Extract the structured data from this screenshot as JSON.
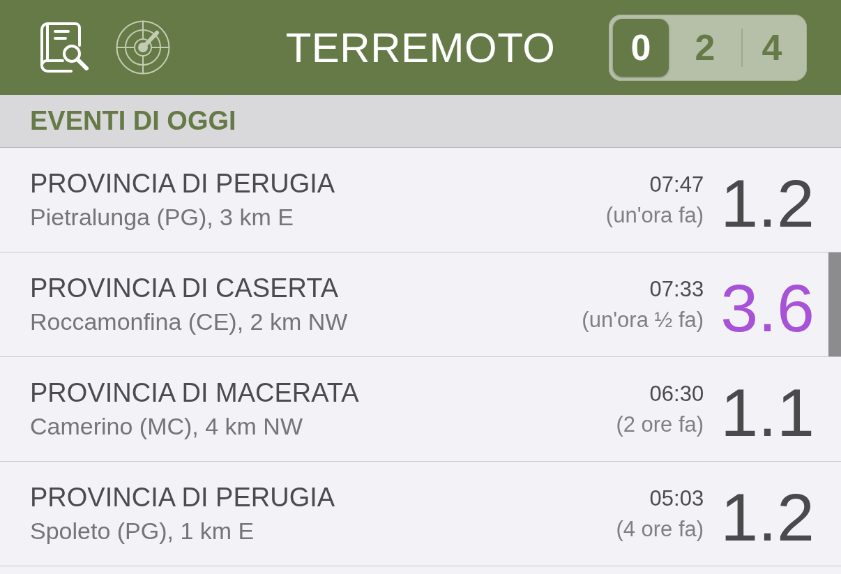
{
  "header": {
    "title": "TERREMOTO",
    "range_selector": [
      {
        "label": "0",
        "selected": true
      },
      {
        "label": "2",
        "selected": false
      },
      {
        "label": "4",
        "selected": false
      }
    ]
  },
  "section": {
    "title": "EVENTI DI OGGI"
  },
  "events": [
    {
      "region": "PROVINCIA DI PERUGIA",
      "place": "Pietralunga (PG), 3 km E",
      "time": "07:47",
      "ago": "(un'ora fa)",
      "magnitude": "1.2",
      "color": "#4a4a4c"
    },
    {
      "region": "PROVINCIA DI CASERTA",
      "place": "Roccamonfina (CE), 2 km NW",
      "time": "07:33",
      "ago": "(un'ora ½ fa)",
      "magnitude": "3.6",
      "color": "#a752d7"
    },
    {
      "region": "PROVINCIA DI MACERATA",
      "place": "Camerino (MC), 4 km NW",
      "time": "06:30",
      "ago": "(2 ore fa)",
      "magnitude": "1.1",
      "color": "#4a4a4c"
    },
    {
      "region": "PROVINCIA DI PERUGIA",
      "place": "Spoleto (PG), 1 km E",
      "time": "05:03",
      "ago": "(4 ore fa)",
      "magnitude": "1.2",
      "color": "#4a4a4c"
    }
  ]
}
